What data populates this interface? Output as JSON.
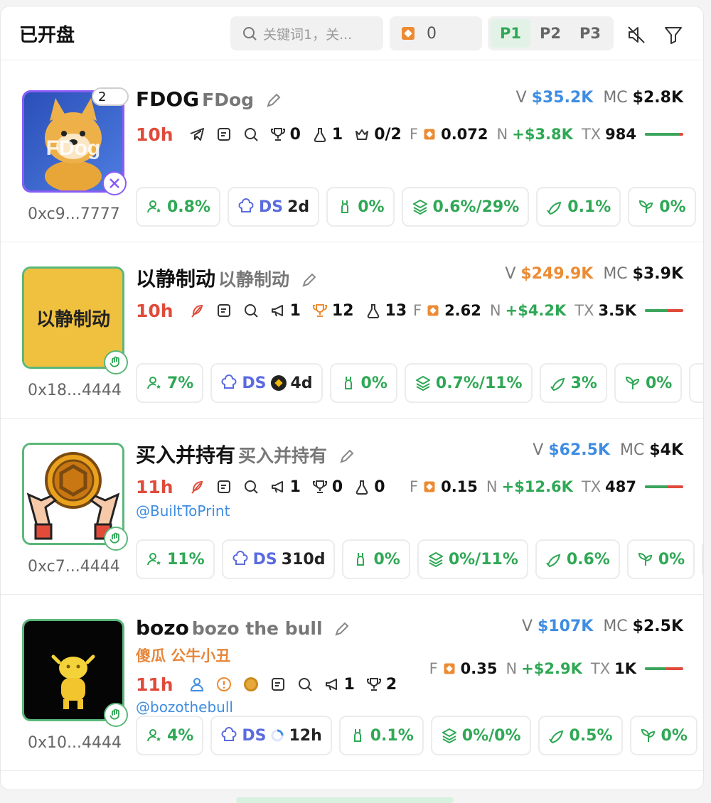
{
  "header": {
    "title": "已开盘",
    "search_placeholder": "关键词1，关...",
    "amount": "0",
    "pages": [
      "P1",
      "P2",
      "P3"
    ],
    "active_page": "P1"
  },
  "tokens": [
    {
      "symbol": "FDOG",
      "name": "FDog",
      "address": "0xc9...7777",
      "age": "10h",
      "badge_count": "2",
      "v_label": "V",
      "volume": "$35.2K",
      "mc_label": "MC",
      "market_cap": "$2.8K",
      "stats": {
        "holders_top": "0",
        "holders": "1",
        "crown": "0/2"
      },
      "f_label": "F",
      "f_value": "0.072",
      "n_label": "N",
      "n_value": "+$3.8K",
      "tx_label": "TX",
      "tx_value": "984",
      "buy_ratio": 0.9,
      "chips": {
        "holders_pct": "0.8%",
        "ds_label": "DS",
        "ds_value": "2d",
        "gift": "0%",
        "layers": "0.6%/29%",
        "fish": "0.1%",
        "sprout": "0%"
      }
    },
    {
      "symbol": "以静制动",
      "name": "以静制动",
      "address": "0x18...4444",
      "age": "10h",
      "avatar_text": "以静制动",
      "v_label": "V",
      "volume": "$249.9K",
      "mc_label": "MC",
      "market_cap": "$3.9K",
      "stats": {
        "speaker": "1",
        "trophy": "12",
        "holders": "13"
      },
      "f_label": "F",
      "f_value": "2.62",
      "n_label": "N",
      "n_value": "+$4.2K",
      "tx_label": "TX",
      "tx_value": "3.5K",
      "buy_ratio": 0.6,
      "chips": {
        "holders_pct": "7%",
        "ds_label": "DS",
        "ds_value": "4d",
        "gift": "0%",
        "layers": "0.7%/11%",
        "fish": "3%",
        "sprout": "0%"
      }
    },
    {
      "symbol": "买入并持有",
      "name": "买入并持有",
      "address": "0xc7...4444",
      "age": "11h",
      "handle": "@BuiltToPrint",
      "v_label": "V",
      "volume": "$62.5K",
      "mc_label": "MC",
      "market_cap": "$4K",
      "stats": {
        "speaker": "1",
        "trophy": "0",
        "holders": "0"
      },
      "f_label": "F",
      "f_value": "0.15",
      "n_label": "N",
      "n_value": "+$12.6K",
      "tx_label": "TX",
      "tx_value": "487",
      "buy_ratio": 0.6,
      "chips": {
        "holders_pct": "11%",
        "ds_label": "DS",
        "ds_value": "310d",
        "gift": "0%",
        "layers": "0%/11%",
        "fish": "0.6%",
        "sprout": "0%"
      }
    },
    {
      "symbol": "bozo",
      "name": "bozo the bull",
      "alias": "傻瓜 公牛小丑",
      "address": "0x10...4444",
      "age": "11h",
      "handle": "@bozothebull",
      "v_label": "V",
      "volume": "$107K",
      "mc_label": "MC",
      "market_cap": "$2.5K",
      "stats": {
        "speaker": "1",
        "trophy": "2"
      },
      "f_label": "F",
      "f_value": "0.35",
      "n_label": "N",
      "n_value": "+$2.9K",
      "tx_label": "TX",
      "tx_value": "1K",
      "buy_ratio": 0.55,
      "chips": {
        "holders_pct": "4%",
        "ds_label": "DS",
        "ds_value": "12h",
        "gift": "0.1%",
        "layers": "0%/0%",
        "fish": "0.5%",
        "sprout": "0%"
      }
    }
  ],
  "colors": {
    "accent_green": "#2fa855",
    "blue": "#3f8de2",
    "orange": "#ec8b33",
    "red": "#e04a3a",
    "ds_blue": "#5a6be0"
  }
}
